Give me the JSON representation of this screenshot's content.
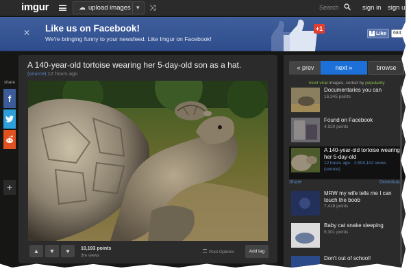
{
  "nav": {
    "logo": "imgur",
    "upload_label": "upload images",
    "search_placeholder": "Search",
    "signin": "sign in",
    "signup": "sign up"
  },
  "banner": {
    "title": "Like us on Facebook!",
    "subtitle": "We're bringing funny to your newsfeed. Like Imgur on Facebook!",
    "badge": "+1",
    "like_label": "Like",
    "like_count": "684k"
  },
  "sharebar": {
    "label": "share"
  },
  "post": {
    "title": "A 140-year-old tortoise wearing her 5-day-old son as a hat.",
    "source": "(source)",
    "time": "12 hours ago",
    "points": "10,193 points",
    "views": "3m views",
    "post_options": "Post Options",
    "add_tag": "Add tag"
  },
  "sidebar": {
    "prev": "« prev",
    "next": "next »",
    "browse": "browse",
    "sort_prefix": "most viral",
    "sort_middle": " images, sorted by ",
    "sort_key": "popularity",
    "share": "Share",
    "download": "Download",
    "items": [
      {
        "title": "Documentaries you can",
        "meta": "16,345 points"
      },
      {
        "title": "Found on Facebook",
        "meta": "4,920 points"
      },
      {
        "title": "A 140-year-old tortoise wearing her 5-day-old",
        "meta": "12 hours ago · 2,504,102 views",
        "meta2": "(source)"
      },
      {
        "title": "MRW my wife tells me I can touch the boob",
        "meta": "7,418 points"
      },
      {
        "title": "Baby cat snake sleeping",
        "meta": "9,301 points"
      },
      {
        "title": "Don't out of school!",
        "meta": ""
      }
    ]
  }
}
